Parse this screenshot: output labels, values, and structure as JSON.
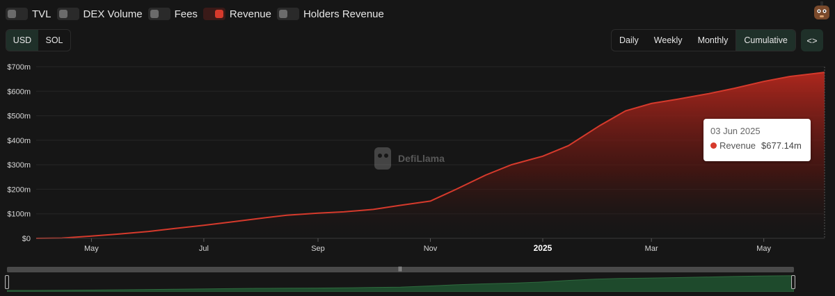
{
  "legend": [
    {
      "label": "TVL",
      "on": false
    },
    {
      "label": "DEX Volume",
      "on": false
    },
    {
      "label": "Fees",
      "on": false
    },
    {
      "label": "Revenue",
      "on": true
    },
    {
      "label": "Holders Revenue",
      "on": false
    }
  ],
  "currency": {
    "options": [
      "USD",
      "SOL"
    ],
    "selected": "USD"
  },
  "period": {
    "options": [
      "Daily",
      "Weekly",
      "Monthly",
      "Cumulative"
    ],
    "selected": "Cumulative"
  },
  "embed_label": "<>",
  "watermark": "DefiLlama",
  "tooltip": {
    "date": "03 Jun 2025",
    "series": "Revenue",
    "value": "$677.14m"
  },
  "colors": {
    "accent": "#d63a2c",
    "active_button": "#1f3029",
    "brush_fill": "#1e4a2c"
  },
  "chart_data": {
    "type": "area",
    "series": [
      {
        "name": "Revenue",
        "color": "#d63a2c",
        "points": [
          [
            "2024-04-01",
            0
          ],
          [
            "2024-04-15",
            1
          ],
          [
            "2024-05-01",
            9
          ],
          [
            "2024-05-15",
            17
          ],
          [
            "2024-06-01",
            28
          ],
          [
            "2024-06-15",
            40
          ],
          [
            "2024-07-01",
            53
          ],
          [
            "2024-07-15",
            66
          ],
          [
            "2024-08-01",
            82
          ],
          [
            "2024-08-15",
            94
          ],
          [
            "2024-09-01",
            103
          ],
          [
            "2024-09-15",
            108
          ],
          [
            "2024-10-01",
            118
          ],
          [
            "2024-10-15",
            134
          ],
          [
            "2024-11-01",
            152
          ],
          [
            "2024-11-15",
            200
          ],
          [
            "2024-12-01",
            258
          ],
          [
            "2024-12-15",
            300
          ],
          [
            "2025-01-01",
            335
          ],
          [
            "2025-01-15",
            378
          ],
          [
            "2025-02-01",
            460
          ],
          [
            "2025-02-15",
            520
          ],
          [
            "2025-03-01",
            550
          ],
          [
            "2025-03-15",
            567
          ],
          [
            "2025-04-01",
            590
          ],
          [
            "2025-04-15",
            612
          ],
          [
            "2025-05-01",
            640
          ],
          [
            "2025-05-15",
            660
          ],
          [
            "2025-06-03",
            677.14
          ]
        ]
      }
    ],
    "y_unit": "$m",
    "ylim": [
      0,
      700
    ],
    "y_ticks": [
      "$0",
      "$100m",
      "$200m",
      "$300m",
      "$400m",
      "$500m",
      "$600m",
      "$700m"
    ],
    "x_ticks": [
      {
        "label": "May",
        "date": "2024-05-01"
      },
      {
        "label": "Jul",
        "date": "2024-07-01"
      },
      {
        "label": "Sep",
        "date": "2024-09-01"
      },
      {
        "label": "Nov",
        "date": "2024-11-01"
      },
      {
        "label": "2025",
        "date": "2025-01-01",
        "bold": true
      },
      {
        "label": "Mar",
        "date": "2025-03-01"
      },
      {
        "label": "May",
        "date": "2025-05-01"
      }
    ],
    "grid": true,
    "legend_position": "top-left"
  }
}
